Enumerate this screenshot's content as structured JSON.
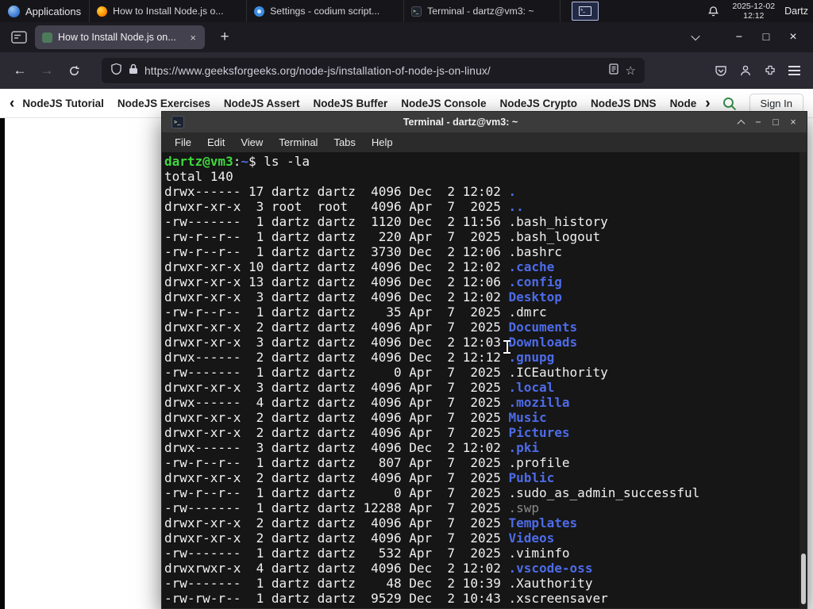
{
  "colors": {
    "accent_green": "#2f8d46",
    "terminal_green": "#3ed83e",
    "terminal_blue": "#4d6be8",
    "terminal_dim": "#8a8a8a",
    "terminal_fg": "#f0f0f0",
    "terminal_bg": "#161616"
  },
  "glyphs": {
    "back": "←",
    "forward": "→",
    "star": "☆",
    "plus": "+",
    "minimize": "−",
    "maximize": "□",
    "close": "×"
  },
  "panel": {
    "applications_label": "Applications",
    "windows": [
      {
        "icon": "firefox",
        "title": "How to Install Node.js o..."
      },
      {
        "icon": "settings",
        "title": "Settings - codium script..."
      },
      {
        "icon": "terminal",
        "title": "Terminal - dartz@vm3: ~"
      }
    ],
    "clock_date": "2025-12-02",
    "clock_time": "12:12",
    "user_label": "Dartz"
  },
  "browser": {
    "tab_title": "How to Install Node.js on...",
    "url": "https://www.geeksforgeeks.org/node-js/installation-of-node-js-on-linux/"
  },
  "site_nav": {
    "items": [
      "NodeJS Tutorial",
      "NodeJS Exercises",
      "NodeJS Assert",
      "NodeJS Buffer",
      "NodeJS Console",
      "NodeJS Crypto",
      "NodeJS DNS",
      "Node"
    ],
    "sign_in_label": "Sign In"
  },
  "terminal": {
    "window_title": "Terminal - dartz@vm3: ~",
    "menu": [
      "File",
      "Edit",
      "View",
      "Terminal",
      "Tabs",
      "Help"
    ],
    "prompt_user_host": "dartz@vm3",
    "prompt_colon": ":",
    "prompt_path": "~",
    "prompt_symbol": "$ ",
    "command": "ls -la",
    "total_line": "total 140",
    "listing": [
      {
        "meta": "drwx------ 17 dartz dartz  4096 Dec  2 12:02 ",
        "name": ".",
        "type": "dir"
      },
      {
        "meta": "drwxr-xr-x  3 root  root   4096 Apr  7  2025 ",
        "name": "..",
        "type": "dir"
      },
      {
        "meta": "-rw-------  1 dartz dartz  1120 Dec  2 11:56 ",
        "name": ".bash_history",
        "type": "file"
      },
      {
        "meta": "-rw-r--r--  1 dartz dartz   220 Apr  7  2025 ",
        "name": ".bash_logout",
        "type": "file"
      },
      {
        "meta": "-rw-r--r--  1 dartz dartz  3730 Dec  2 12:06 ",
        "name": ".bashrc",
        "type": "file"
      },
      {
        "meta": "drwxr-xr-x 10 dartz dartz  4096 Dec  2 12:02 ",
        "name": ".cache",
        "type": "dir"
      },
      {
        "meta": "drwxr-xr-x 13 dartz dartz  4096 Dec  2 12:06 ",
        "name": ".config",
        "type": "dir"
      },
      {
        "meta": "drwxr-xr-x  3 dartz dartz  4096 Dec  2 12:02 ",
        "name": "Desktop",
        "type": "dir"
      },
      {
        "meta": "-rw-r--r--  1 dartz dartz    35 Apr  7  2025 ",
        "name": ".dmrc",
        "type": "file"
      },
      {
        "meta": "drwxr-xr-x  2 dartz dartz  4096 Apr  7  2025 ",
        "name": "Documents",
        "type": "dir"
      },
      {
        "meta": "drwxr-xr-x  3 dartz dartz  4096 Dec  2 12:03 ",
        "name": "Downloads",
        "type": "dir"
      },
      {
        "meta": "drwx------  2 dartz dartz  4096 Dec  2 12:12 ",
        "name": ".gnupg",
        "type": "dir"
      },
      {
        "meta": "-rw-------  1 dartz dartz     0 Apr  7  2025 ",
        "name": ".ICEauthority",
        "type": "file"
      },
      {
        "meta": "drwxr-xr-x  3 dartz dartz  4096 Apr  7  2025 ",
        "name": ".local",
        "type": "dir"
      },
      {
        "meta": "drwx------  4 dartz dartz  4096 Apr  7  2025 ",
        "name": ".mozilla",
        "type": "dir"
      },
      {
        "meta": "drwxr-xr-x  2 dartz dartz  4096 Apr  7  2025 ",
        "name": "Music",
        "type": "dir"
      },
      {
        "meta": "drwxr-xr-x  2 dartz dartz  4096 Apr  7  2025 ",
        "name": "Pictures",
        "type": "dir"
      },
      {
        "meta": "drwx------  3 dartz dartz  4096 Dec  2 12:02 ",
        "name": ".pki",
        "type": "dir"
      },
      {
        "meta": "-rw-r--r--  1 dartz dartz   807 Apr  7  2025 ",
        "name": ".profile",
        "type": "file"
      },
      {
        "meta": "drwxr-xr-x  2 dartz dartz  4096 Apr  7  2025 ",
        "name": "Public",
        "type": "dir"
      },
      {
        "meta": "-rw-r--r--  1 dartz dartz     0 Apr  7  2025 ",
        "name": ".sudo_as_admin_successful",
        "type": "file"
      },
      {
        "meta": "-rw-------  1 dartz dartz 12288 Apr  7  2025 ",
        "name": ".swp",
        "type": "dim"
      },
      {
        "meta": "drwxr-xr-x  2 dartz dartz  4096 Apr  7  2025 ",
        "name": "Templates",
        "type": "dir"
      },
      {
        "meta": "drwxr-xr-x  2 dartz dartz  4096 Apr  7  2025 ",
        "name": "Videos",
        "type": "dir"
      },
      {
        "meta": "-rw-------  1 dartz dartz   532 Apr  7  2025 ",
        "name": ".viminfo",
        "type": "file"
      },
      {
        "meta": "drwxrwxr-x  4 dartz dartz  4096 Dec  2 12:02 ",
        "name": ".vscode-oss",
        "type": "dir"
      },
      {
        "meta": "-rw-------  1 dartz dartz    48 Dec  2 10:39 ",
        "name": ".Xauthority",
        "type": "file"
      },
      {
        "meta": "-rw-rw-r--  1 dartz dartz  9529 Dec  2 10:43 ",
        "name": ".xscreensaver",
        "type": "file"
      }
    ]
  }
}
